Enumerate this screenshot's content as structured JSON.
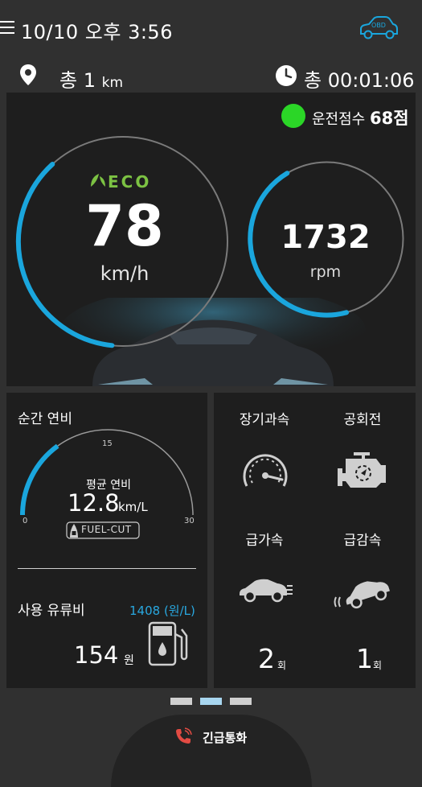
{
  "status_bar": {
    "datetime": "10/10 오후 3:56",
    "obd_label": "OBD"
  },
  "trip": {
    "distance_prefix": "총 1",
    "distance_unit": "km",
    "duration": "총 00:01:06"
  },
  "score": {
    "label": "운전점수",
    "value": "68점",
    "color": "#2bd627"
  },
  "speedometer": {
    "eco_label": "ECO",
    "value": "78",
    "unit": "km/h",
    "fill_fraction": 0.26
  },
  "tachometer": {
    "value": "1732",
    "unit": "rpm",
    "fill_fraction": 0.33
  },
  "fuel_efficiency": {
    "title": "순간 연비",
    "avg_label": "평균 연비",
    "avg_value": "12.8",
    "avg_unit": "km/L",
    "scale_min": "0",
    "scale_mid": "15",
    "scale_max": "30",
    "fill_fraction": 0.3,
    "fuel_cut_label": "FUEL-CUT"
  },
  "fuel_cost": {
    "title": "사용 유류비",
    "price": "1408 (원/L)",
    "value": "154",
    "unit": "원"
  },
  "events": [
    {
      "label": "장기과속",
      "icon": "speedometer-icon"
    },
    {
      "label": "공회전",
      "icon": "engine-icon"
    },
    {
      "label": "급가속",
      "icon": "accelerating-car-icon",
      "count": "2",
      "unit": "회"
    },
    {
      "label": "급감속",
      "icon": "braking-car-icon",
      "count": "1",
      "unit": "회"
    }
  ],
  "pagination": {
    "pages": 3,
    "active": 2
  },
  "emergency": {
    "label": "긴급통화"
  },
  "colors": {
    "accent": "#1aa6dd",
    "background": "#303030",
    "panel": "#1e1e1e",
    "eco_green": "#7cc243",
    "phone_red": "#e24b43"
  }
}
